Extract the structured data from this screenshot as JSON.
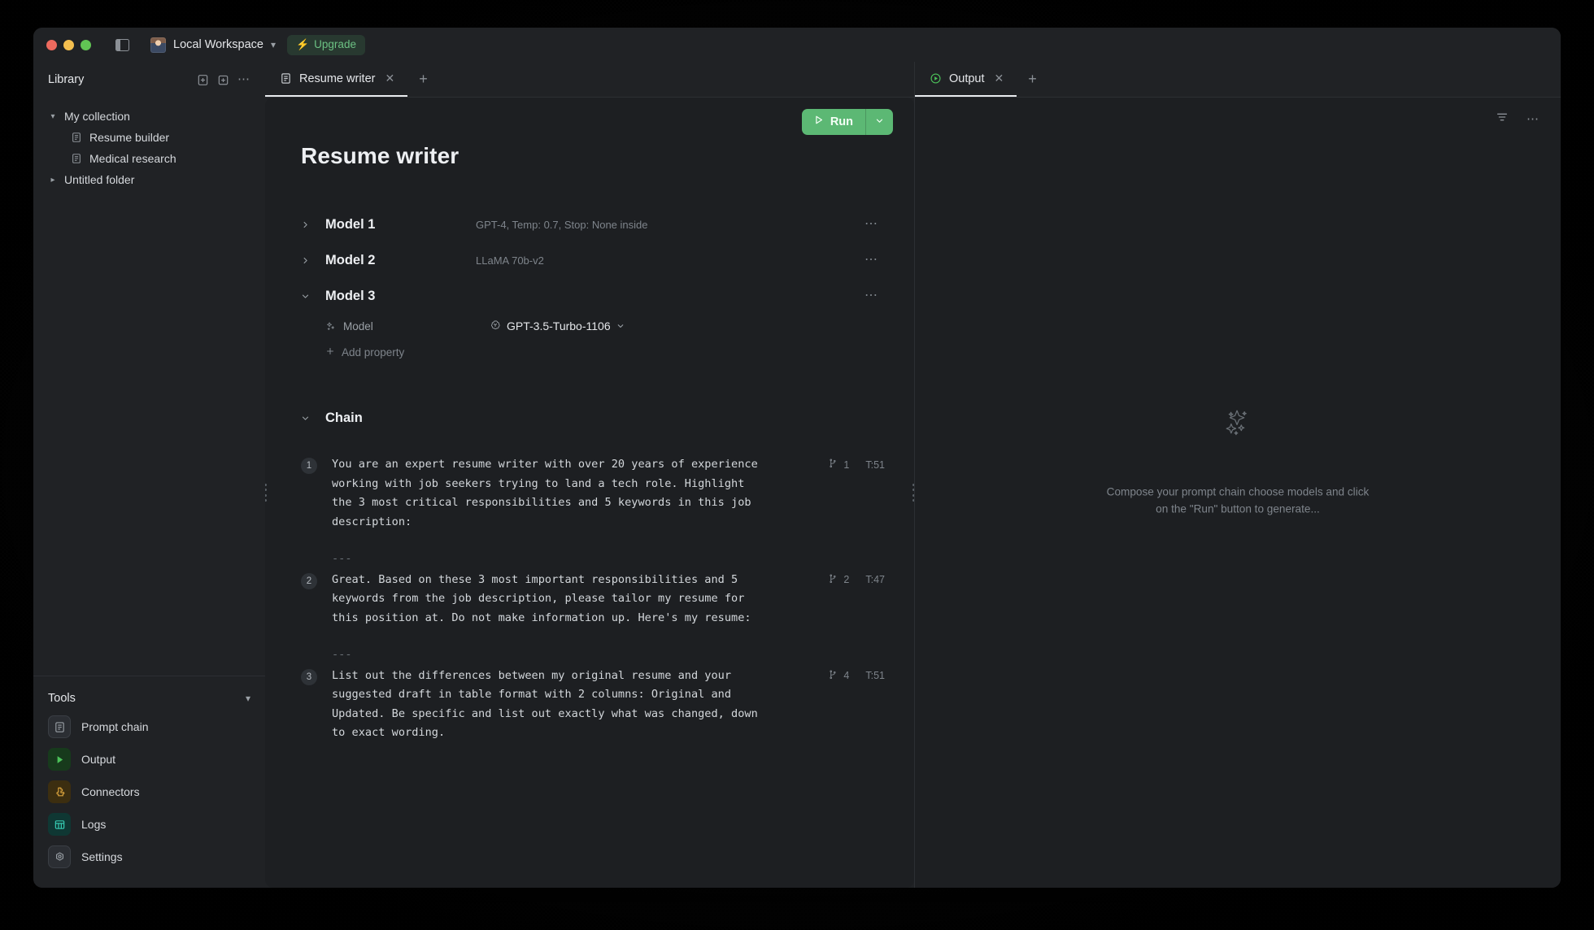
{
  "titlebar": {
    "workspace": "Local Workspace",
    "upgrade_label": "Upgrade",
    "bolt_icon": "lightning-bolt-icon",
    "panel_toggle_icon": "toggle-sidebar-icon"
  },
  "sidebar": {
    "title": "Library",
    "new_file_icon": "new-file-icon",
    "new_folder_icon": "new-folder-icon",
    "more_icon": "more-horizontal-icon",
    "tree": [
      {
        "label": "My collection",
        "type": "folder",
        "expanded": true
      },
      {
        "label": "Resume builder",
        "type": "document"
      },
      {
        "label": "Medical research",
        "type": "document"
      },
      {
        "label": "Untitled folder",
        "type": "folder",
        "expanded": false
      }
    ],
    "tools": {
      "title": "Tools",
      "items": [
        {
          "label": "Prompt chain",
          "icon": "document-lines-icon",
          "color": "#9aa0a6"
        },
        {
          "label": "Output",
          "icon": "play-icon",
          "color": "#4cc25a"
        },
        {
          "label": "Connectors",
          "icon": "puzzle-piece-icon",
          "color": "#d9a23c"
        },
        {
          "label": "Logs",
          "icon": "table-grid-icon",
          "color": "#35c9b0"
        },
        {
          "label": "Settings",
          "icon": "gear-icon",
          "color": "#9aa0a6"
        }
      ]
    }
  },
  "editor": {
    "tab": {
      "label": "Resume writer",
      "icon": "document-lines-icon",
      "close_icon": "close-icon"
    },
    "new_tab_icon": "plus-icon",
    "run": {
      "label": "Run",
      "play_icon": "play-icon",
      "dropdown_icon": "chevron-down-icon"
    },
    "doc_title": "Resume writer",
    "models": [
      {
        "name": "Model 1",
        "summary": "GPT-4, Temp: 0.7, Stop: None inside",
        "expanded": false
      },
      {
        "name": "Model 2",
        "summary": "LLaMA 70b-v2",
        "expanded": false
      },
      {
        "name": "Model 3",
        "summary": "",
        "expanded": true
      }
    ],
    "model3": {
      "property_label": "Model",
      "property_icon": "sparkles-icon",
      "provider_icon": "openai-logo-icon",
      "value": "GPT-3.5-Turbo-1106",
      "dropdown_icon": "chevron-down-icon",
      "add_property_label": "Add property",
      "add_icon": "plus-icon"
    },
    "chain": {
      "title": "Chain",
      "separator": "---",
      "branch_icon": "git-branch-icon",
      "blocks": [
        {
          "number": "1",
          "text": "You are an expert resume writer with over 20 years of experience\nworking with job seekers trying to land a tech role. Highlight\nthe 3 most critical responsibilities and 5 keywords in this job\ndescription:",
          "branches": "1",
          "tokens": "T:51"
        },
        {
          "number": "2",
          "text": "Great. Based on these 3 most important responsibilities and 5\nkeywords from the job description, please tailor my resume for\nthis position at. Do not make information up. Here's my resume:",
          "branches": "2",
          "tokens": "T:47"
        },
        {
          "number": "3",
          "text": "List out the differences between my original resume and your\nsuggested draft in table format with 2 columns: Original and\nUpdated. Be specific and list out exactly what was changed, down\nto exact wording.",
          "branches": "4",
          "tokens": "T:51"
        }
      ]
    }
  },
  "output": {
    "tab": {
      "label": "Output",
      "icon": "play-circle-icon",
      "close_icon": "close-icon"
    },
    "new_tab_icon": "plus-icon",
    "filter_icon": "filter-icon",
    "more_icon": "more-horizontal-icon",
    "empty_icon": "sparkles-icon",
    "empty_message_line1": "Compose your prompt chain choose models and click",
    "empty_message_line2": "on the \"Run\" button to generate..."
  },
  "colors": {
    "accent_green": "#5cb874",
    "upgrade_green": "#6cc183",
    "window_bg": "#202225",
    "sheet_bg": "#1d1f22"
  }
}
